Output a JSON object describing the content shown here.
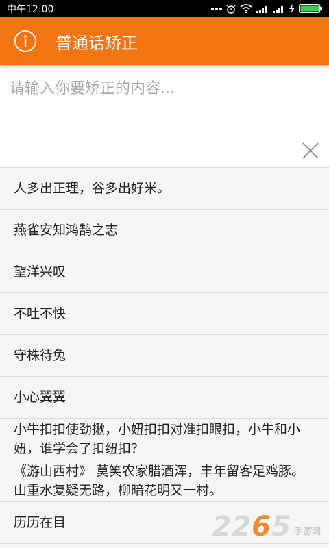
{
  "status_bar": {
    "time": "中午12:00",
    "icons": [
      "more-dots-icon",
      "alarm-icon",
      "wifi-icon",
      "signal-icon",
      "signal-icon",
      "charging-icon",
      "battery-icon"
    ]
  },
  "app_bar": {
    "icon": "info-icon",
    "title": "普通话矫正"
  },
  "input": {
    "placeholder": "请输入你要矫正的内容...",
    "value": "",
    "clear_icon": "close-icon"
  },
  "list": {
    "items": [
      "人多出正理，谷多出好米。",
      "燕雀安知鸿鹄之志",
      "望洋兴叹",
      "不吐不快",
      "守株待兔",
      "小心翼翼",
      "小牛扣扣使劲揪，小妞扣扣对准扣眼扣，小牛和小妞，谁学会了扣纽扣？",
      "《游山西村》 莫笑农家腊酒浑，丰年留客足鸡豚。山重水复疑无路，柳暗花明又一村。",
      "历历在目"
    ]
  },
  "watermark": {
    "number_prefix": "22",
    "number_accent": "6",
    "number_suffix": "5",
    "text": "手游网"
  },
  "colors": {
    "accent": "#f37413",
    "status_bar": "#000000",
    "divider": "#dcdcdc"
  }
}
